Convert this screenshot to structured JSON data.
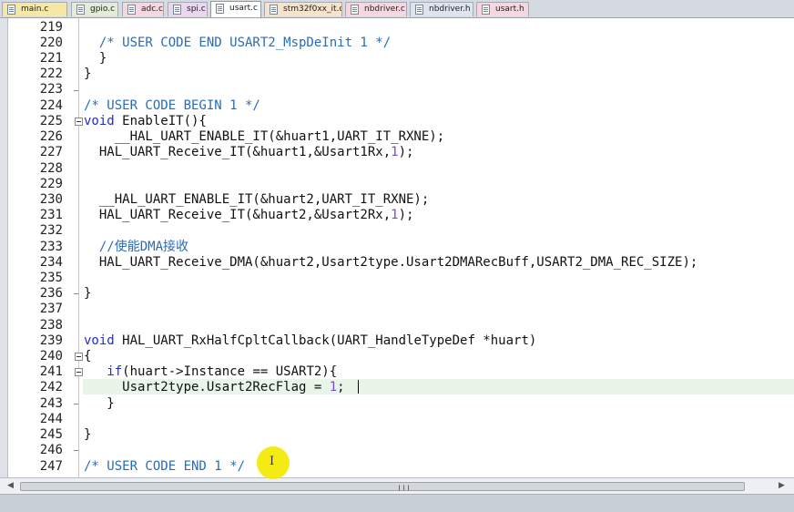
{
  "tabs": [
    {
      "label": "main.c",
      "color": "#f5e7a6",
      "active": false
    },
    {
      "label": "gpio.c",
      "color": "#e4ecd7",
      "active": false
    },
    {
      "label": "adc.c",
      "color": "#f6d7df",
      "active": false
    },
    {
      "label": "spi.c",
      "color": "#ead7ef",
      "active": false
    },
    {
      "label": "usart.c",
      "color": "#ffffff",
      "active": true
    },
    {
      "label": "stm32f0xx_it.c",
      "color": "#f6e3cb",
      "active": false
    },
    {
      "label": "nbdriver.c",
      "color": "#f6d7df",
      "active": false
    },
    {
      "label": "nbdriver.h",
      "color": "#dfe3ee",
      "active": false
    },
    {
      "label": "usart.h",
      "color": "#f6d7df",
      "active": false
    }
  ],
  "editor": {
    "current_line": "242",
    "lines": [
      {
        "n": "219",
        "text": ""
      },
      {
        "n": "220",
        "text": "  /* USER CODE END USART2_MspDeInit 1 */"
      },
      {
        "n": "221",
        "text": "  }"
      },
      {
        "n": "222",
        "text": "}"
      },
      {
        "n": "223",
        "text": ""
      },
      {
        "n": "224",
        "text": "/* USER CODE BEGIN 1 */"
      },
      {
        "n": "225",
        "text": "void EnableIT(){"
      },
      {
        "n": "226",
        "text": "    __HAL_UART_ENABLE_IT(&huart1,UART_IT_RXNE);"
      },
      {
        "n": "227",
        "text": "  HAL_UART_Receive_IT(&huart1,&Usart1Rx,1);"
      },
      {
        "n": "228",
        "text": ""
      },
      {
        "n": "229",
        "text": ""
      },
      {
        "n": "230",
        "text": "  __HAL_UART_ENABLE_IT(&huart2,UART_IT_RXNE);"
      },
      {
        "n": "231",
        "text": "  HAL_UART_Receive_IT(&huart2,&Usart2Rx,1);"
      },
      {
        "n": "232",
        "text": ""
      },
      {
        "n": "233",
        "text": "  //使能DMA接收"
      },
      {
        "n": "234",
        "text": "  HAL_UART_Receive_DMA(&huart2,Usart2type.Usart2DMARecBuff,USART2_DMA_REC_SIZE);"
      },
      {
        "n": "235",
        "text": ""
      },
      {
        "n": "236",
        "text": "}"
      },
      {
        "n": "237",
        "text": ""
      },
      {
        "n": "238",
        "text": ""
      },
      {
        "n": "239",
        "text": "void HAL_UART_RxHalfCpltCallback(UART_HandleTypeDef *huart)"
      },
      {
        "n": "240",
        "text": "{"
      },
      {
        "n": "241",
        "text": "   if(huart->Instance == USART2){"
      },
      {
        "n": "242",
        "text": "     Usart2type.Usart2RecFlag = 1;"
      },
      {
        "n": "243",
        "text": "   }"
      },
      {
        "n": "244",
        "text": ""
      },
      {
        "n": "245",
        "text": "}"
      },
      {
        "n": "246",
        "text": ""
      },
      {
        "n": "247",
        "text": "/* USER CODE END 1 */"
      }
    ]
  },
  "icons": {
    "file": "file-icon",
    "fold": "fold-minus-icon",
    "cursor": "ibeam-cursor-icon"
  },
  "colors": {
    "comment": "#2b6cb5",
    "keyword": "#1c2fd4",
    "number": "#7a4bc8",
    "current_line_bg": "#e8f5e8",
    "cursor_highlight": "#f4ea14"
  }
}
